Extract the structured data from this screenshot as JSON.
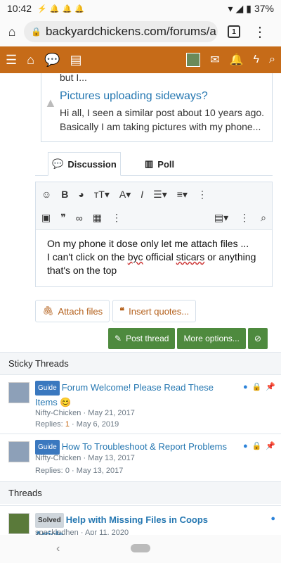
{
  "status_bar": {
    "time": "10:42",
    "battery": "37%",
    "notification_icons": [
      "usb-icon",
      "bell-icon",
      "bell-icon",
      "bell-icon"
    ]
  },
  "browser": {
    "url": "backyardchickens.com/forums/a",
    "tab_count": "1"
  },
  "site_nav": {
    "icons": [
      "menu-icon",
      "home-icon",
      "chat-icon",
      "document-icon",
      "avatar",
      "mail-icon",
      "bell-icon",
      "bolt-icon",
      "search-icon"
    ]
  },
  "quoted_posts": {
    "tail_text": "but I...",
    "title": "Pictures uploading sideways?",
    "body": "Hi all, I seen a similar post about 10 years ago. Basically I am taking pictures with my phone..."
  },
  "editor_tabs": {
    "discussion": "Discussion",
    "poll": "Poll"
  },
  "editor": {
    "line1": "On my phone it dose only let me attach files ...",
    "line2_pre": "I can't click on the ",
    "line2_byc": "byc",
    "line2_mid": " official ",
    "line2_sticars": "sticars",
    "line2_post": " or anything",
    "line3": "that's on the top"
  },
  "buttons": {
    "attach_files": "Attach files",
    "insert_quotes": "Insert quotes...",
    "post_thread": "Post thread",
    "more_options": "More options..."
  },
  "sections": {
    "sticky": "Sticky Threads",
    "threads": "Threads"
  },
  "threads": [
    {
      "prefix": "Guide",
      "title": "Forum Welcome! Please Read These Items",
      "emoji": "😊",
      "author": "Nifty-Chicken",
      "date": "May 21, 2017",
      "replies_label": "Replies:",
      "replies": "1",
      "last": "May 6, 2019"
    },
    {
      "prefix": "Guide",
      "title": "How To Troubleshoot & Report Problems",
      "author": "Nifty-Chicken",
      "date": "May 13, 2017",
      "replies_label": "Replies:",
      "replies": "0",
      "last": "May 13, 2017"
    },
    {
      "prefix": "Solved",
      "title": "Help with Missing Files in Coops Article",
      "author": "speckledhen",
      "date": "Apr 11, 2020"
    }
  ],
  "colors": {
    "brand_orange": "#c66b18",
    "link_blue": "#2577b1",
    "button_green": "#4e8a3e"
  }
}
